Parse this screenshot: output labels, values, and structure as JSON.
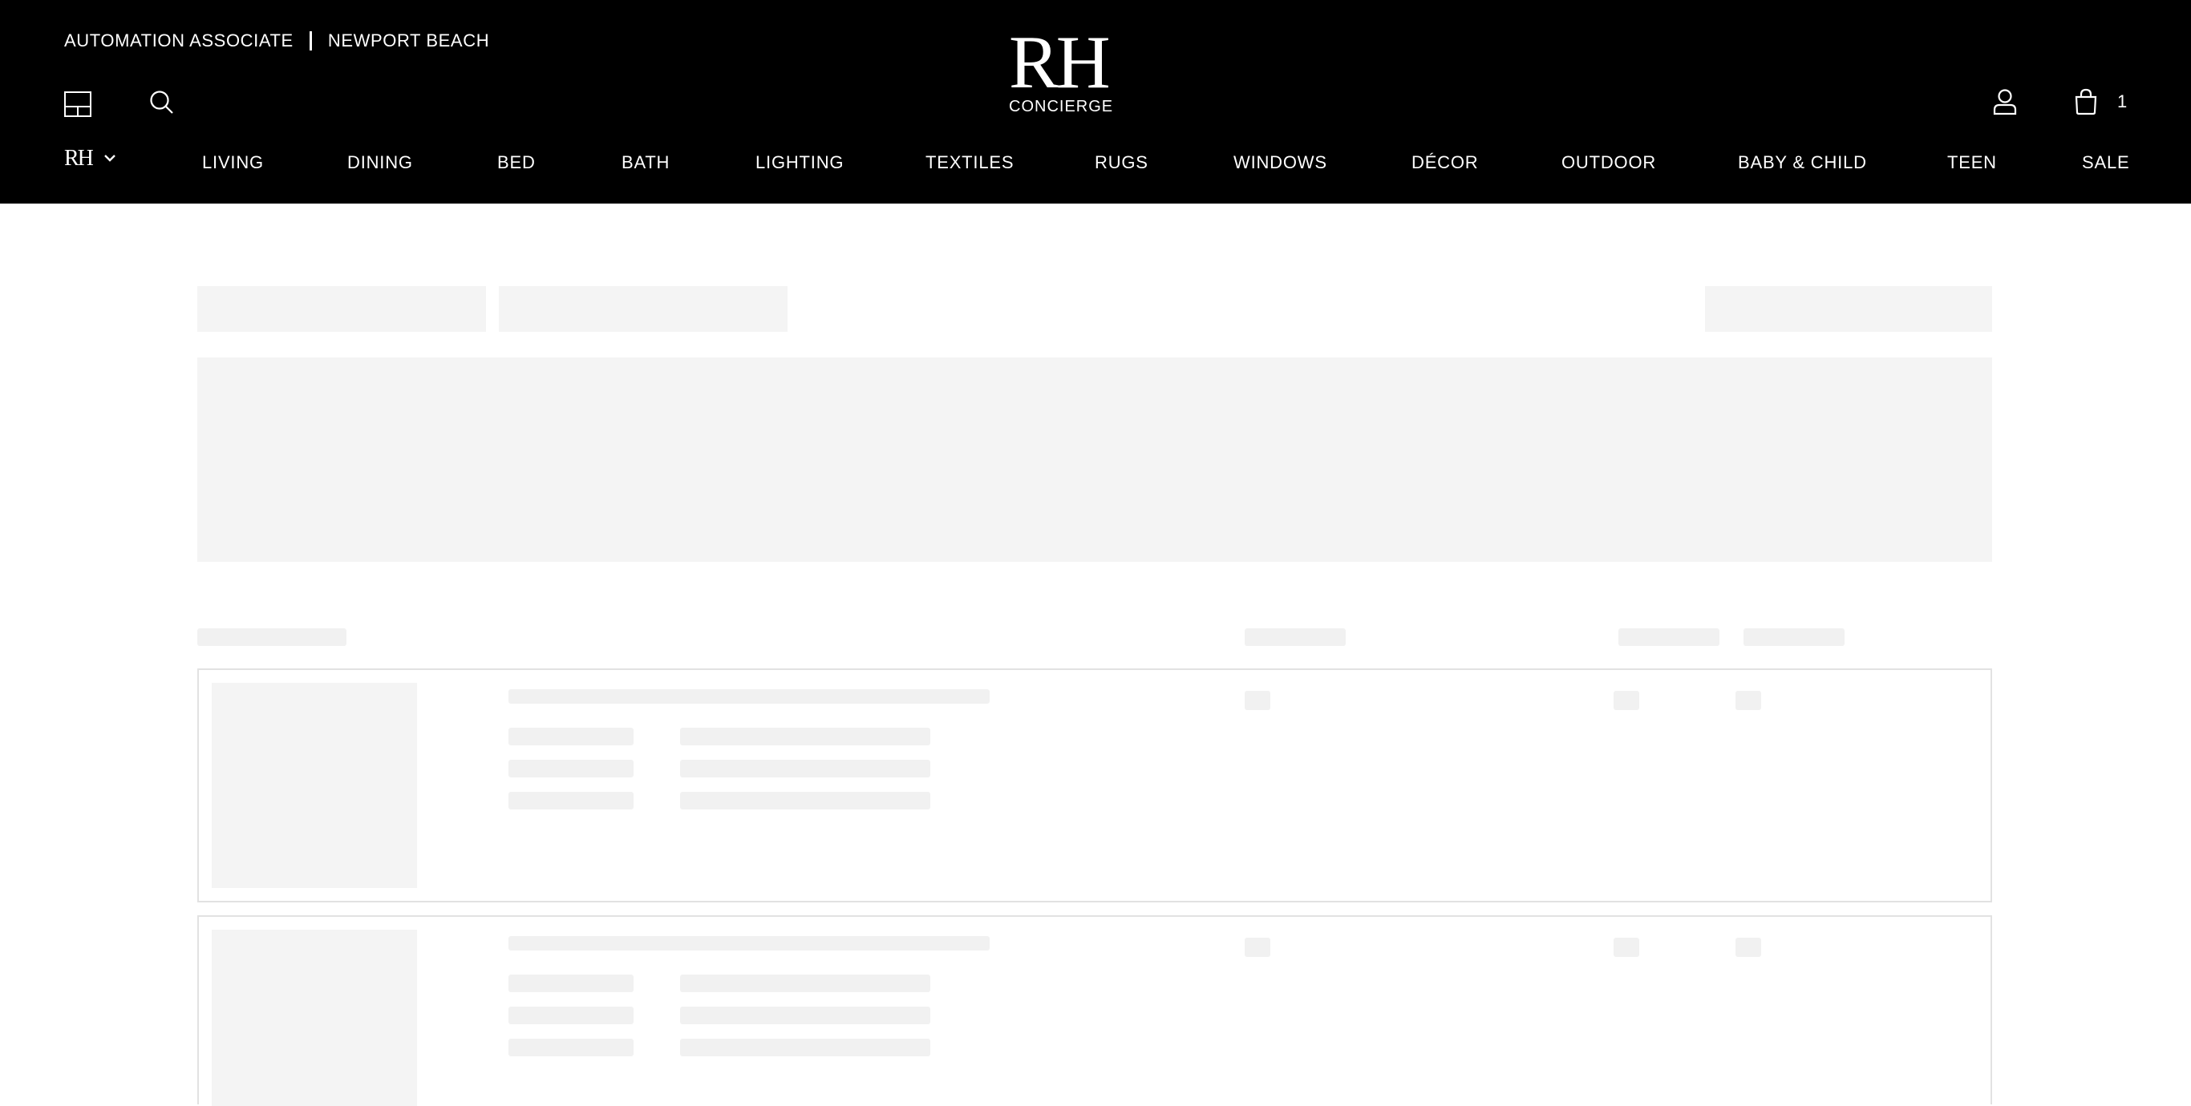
{
  "header": {
    "role": "AUTOMATION ASSOCIATE",
    "location": "NEWPORT BEACH",
    "brand": "RH",
    "brand_sub": "CONCIERGE",
    "cart_count": "1",
    "nav_brand": "RH"
  },
  "nav": {
    "items": [
      "LIVING",
      "DINING",
      "BED",
      "BATH",
      "LIGHTING",
      "TEXTILES",
      "RUGS",
      "WINDOWS",
      "DÉCOR",
      "OUTDOOR",
      "BABY & CHILD",
      "TEEN",
      "SALE"
    ]
  },
  "icons": {
    "gallery": "gallery-grid-icon",
    "search": "search-icon",
    "account": "account-icon",
    "cart": "cart-bag-icon",
    "brand_menu": "chevron-down-icon"
  },
  "colors": {
    "header_bg": "#000000",
    "header_text": "#ffffff",
    "skeleton": "#f4f4f4",
    "card_border": "#e2e2e2"
  }
}
